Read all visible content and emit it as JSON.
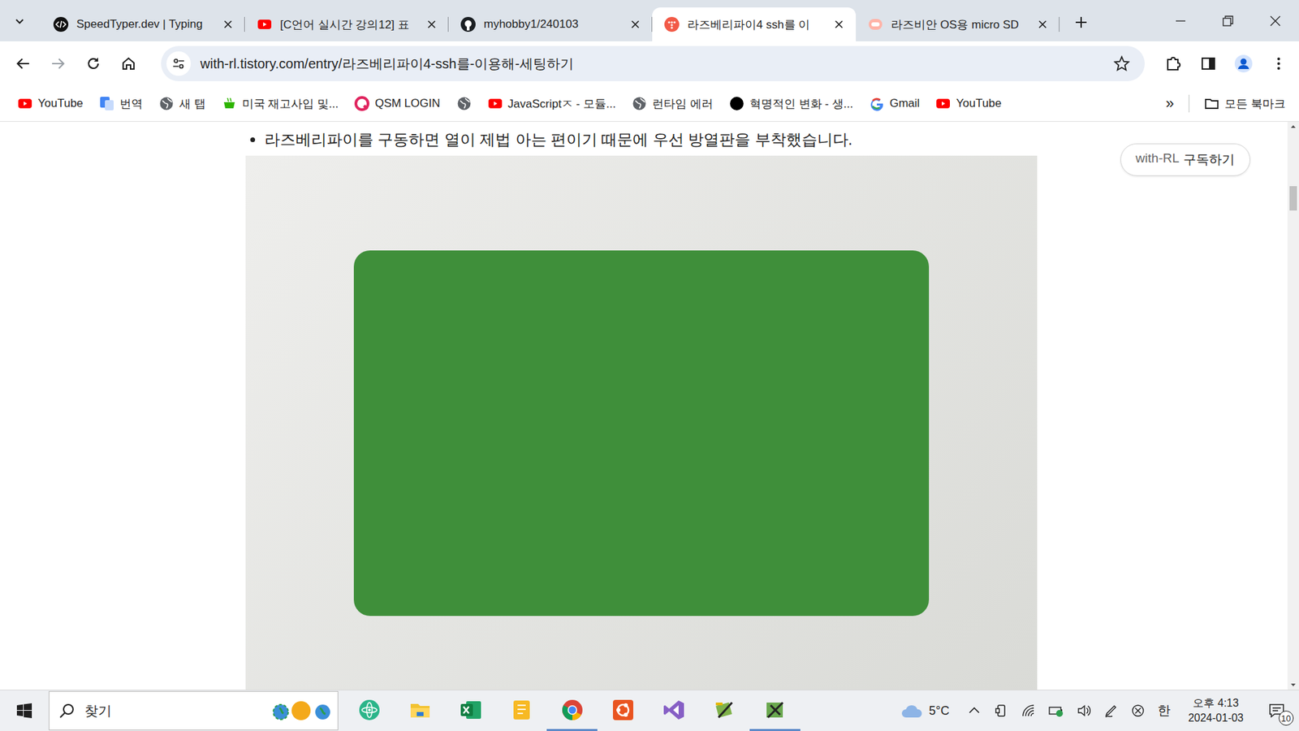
{
  "tabs": [
    {
      "title": "SpeedTyper.dev | Typing",
      "kind": "speedtyper",
      "selected": false
    },
    {
      "title": "[C언어 실시간 강의12] 표",
      "kind": "youtube",
      "selected": false
    },
    {
      "title": "myhobby1/240103",
      "kind": "github",
      "selected": false
    },
    {
      "title": "라즈베리파이4 ssh를 이",
      "kind": "tistory",
      "selected": true
    },
    {
      "title": "라즈비안 OS용 micro SD",
      "kind": "blog",
      "selected": false
    }
  ],
  "address": {
    "url": "with-rl.tistory.com/entry/라즈베리파이4-ssh를-이용해-세팅하기",
    "bookmarked": false
  },
  "bookmarks": [
    {
      "label": "YouTube",
      "kind": "youtube"
    },
    {
      "label": "번역",
      "kind": "translate"
    },
    {
      "label": "새 탭",
      "kind": "globe"
    },
    {
      "label": "미국 재고사입 및...",
      "kind": "cafe"
    },
    {
      "label": "QSM LOGIN",
      "kind": "qsm"
    },
    {
      "label": "",
      "kind": "globe"
    },
    {
      "label": "JavaScriptㅈ - 모듈...",
      "kind": "youtube"
    },
    {
      "label": "런타임 에러",
      "kind": "globe"
    },
    {
      "label": "혁명적인 변화 - 생...",
      "kind": "dot"
    },
    {
      "label": "Gmail",
      "kind": "google"
    },
    {
      "label": "YouTube",
      "kind": "youtube"
    }
  ],
  "bookmarks_more": "»",
  "all_bookmarks": "모든 북마크",
  "article": {
    "bullet": "라즈베리파이를 구동하면 열이 제법 아는 편이기 때문에 우선 방열판을 부착했습니다."
  },
  "subscribe": {
    "name": "with-RL",
    "action": "구독하기"
  },
  "scrollbar": {
    "level": 0.1
  },
  "taskbar": {
    "search": {
      "placeholder": "찾기"
    },
    "apps": [
      {
        "kind": "atom",
        "active": false
      },
      {
        "kind": "explorer",
        "active": false
      },
      {
        "kind": "excel",
        "active": false
      },
      {
        "kind": "notes",
        "active": false
      },
      {
        "kind": "chrome",
        "active": true
      },
      {
        "kind": "ubuntu",
        "active": false
      },
      {
        "kind": "vstudio",
        "active": false
      },
      {
        "kind": "tool",
        "active": false
      },
      {
        "kind": "tool2",
        "active": true
      }
    ],
    "weather": {
      "temp": "5°C"
    },
    "ime": "한",
    "time": "오후 4:13",
    "date": "2024-01-03",
    "notifications": "10"
  }
}
